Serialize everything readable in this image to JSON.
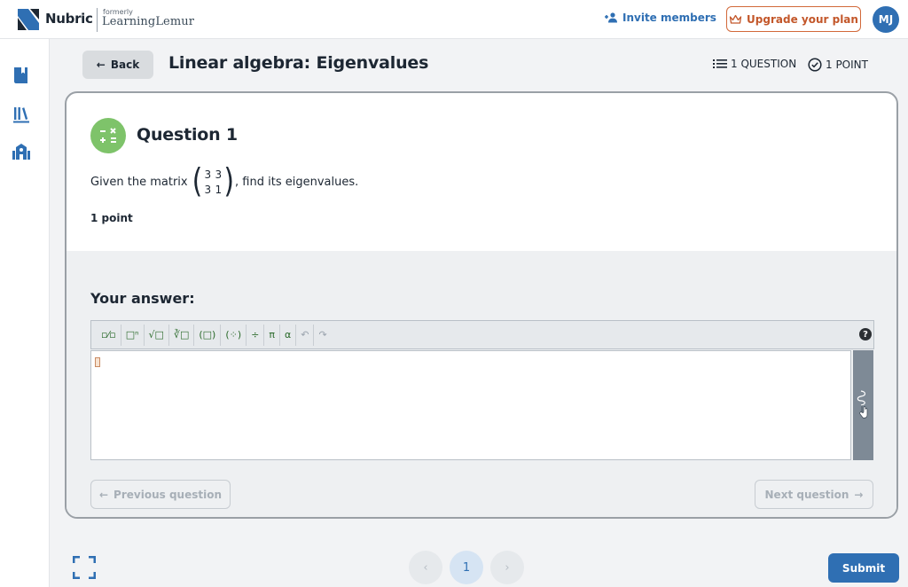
{
  "topbar": {
    "brand": "Nubric",
    "formerly": "formerly",
    "former_name": "LearningLemur",
    "invite_label": "Invite members",
    "upgrade_label": "Upgrade your plan",
    "avatar_initials": "MJ"
  },
  "header": {
    "back_label": "Back",
    "title": "Linear algebra: Eigenvalues",
    "question_count": "1 QUESTION",
    "point_count": "1 POINT"
  },
  "question": {
    "title": "Question 1",
    "prompt_before": "Given the matrix",
    "matrix": [
      "3",
      "3",
      "3",
      "1"
    ],
    "prompt_after": ", find its eigenvalues.",
    "points": "1 point"
  },
  "answer": {
    "label": "Your answer:",
    "toolbar": [
      {
        "name": "fraction-tool",
        "glyph": "▫⁄▫"
      },
      {
        "name": "superscript-tool",
        "glyph": "□ⁿ"
      },
      {
        "name": "sqrt-tool",
        "glyph": "√□"
      },
      {
        "name": "nthroot-tool",
        "glyph": "∛□"
      },
      {
        "name": "parentheses-tool",
        "glyph": "(□)"
      },
      {
        "name": "matrix-tool",
        "glyph": "(⁘)"
      },
      {
        "name": "divide-tool",
        "glyph": "÷"
      },
      {
        "name": "pi-tool",
        "glyph": "π"
      },
      {
        "name": "alpha-tool",
        "glyph": "α"
      },
      {
        "name": "undo-tool",
        "glyph": "↶"
      },
      {
        "name": "redo-tool",
        "glyph": "↷"
      }
    ],
    "help_glyph": "?",
    "prev_label": "Previous question",
    "next_label": "Next question"
  },
  "footer": {
    "page_prev": "‹",
    "current_page": "1",
    "page_next": "›",
    "submit_label": "Submit"
  },
  "colors": {
    "accent": "#2f6fb3",
    "upgrade": "#c3572a",
    "question_badge": "#7ec36a"
  }
}
